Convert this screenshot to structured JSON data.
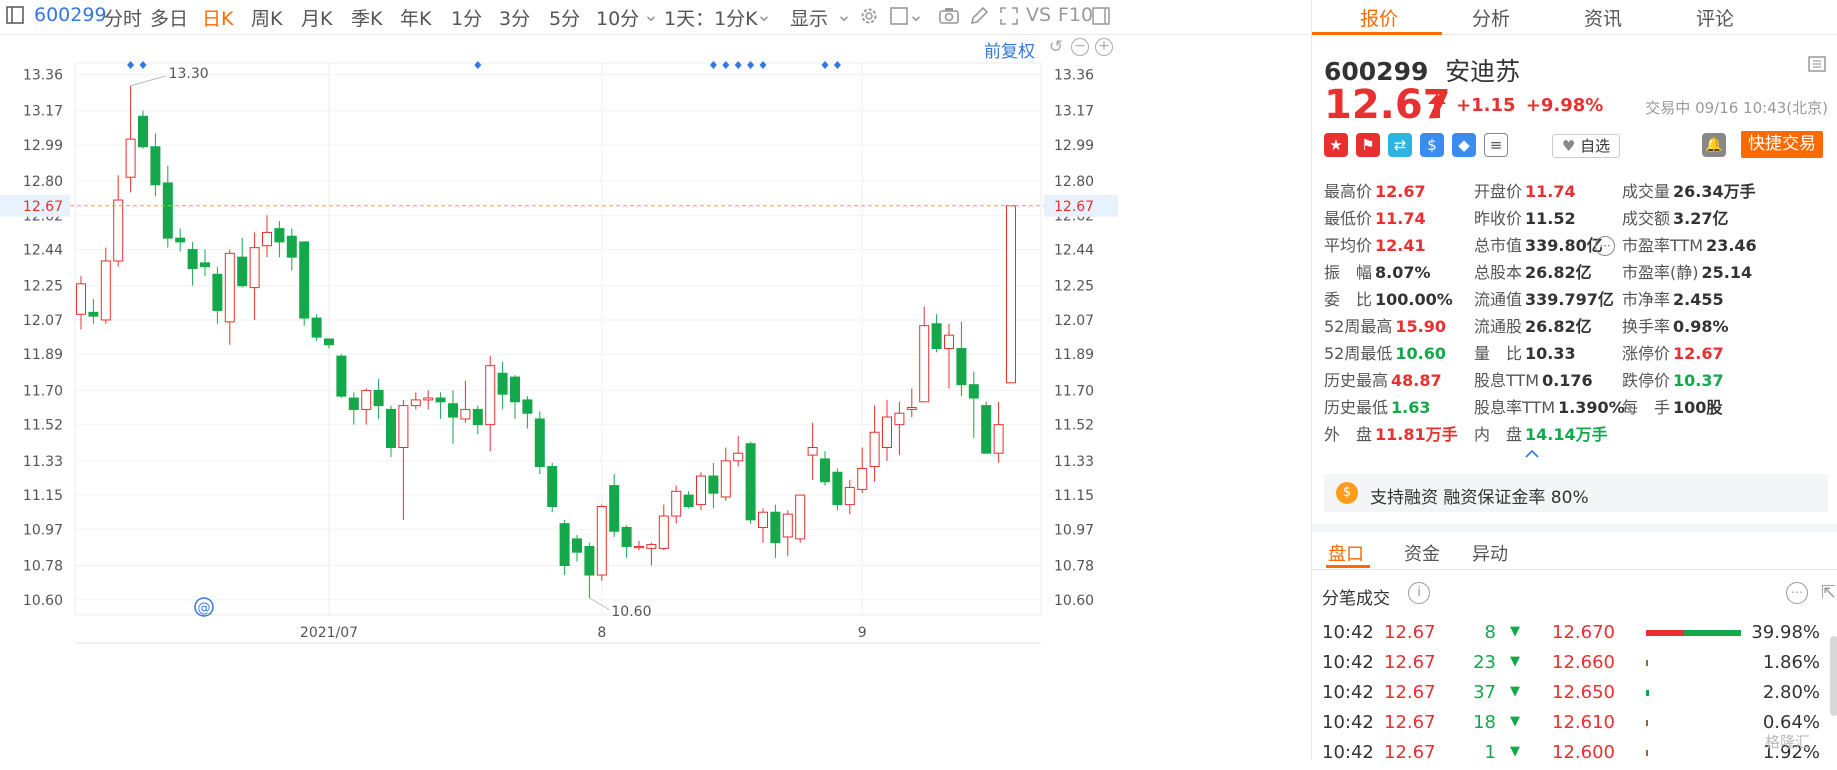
{
  "toolbar": {
    "code": "600299",
    "periods": [
      "分时",
      "多日",
      "日K",
      "周K",
      "月K",
      "季K",
      "年K",
      "1分",
      "3分",
      "5分",
      "10分"
    ],
    "active_period": "日K",
    "minute_select": "1天：1分K",
    "display_label": "显示",
    "vs_label": "VS",
    "f10_label": "F10",
    "adjust_label": "前复权"
  },
  "chart": {
    "y_ticks": [
      "13.36",
      "13.17",
      "12.99",
      "12.80",
      "12.62",
      "12.44",
      "12.25",
      "12.07",
      "11.89",
      "11.70",
      "11.52",
      "11.33",
      "11.15",
      "10.97",
      "10.78",
      "10.60"
    ],
    "x_labels": [
      {
        "text": "2021/07",
        "index": 20
      },
      {
        "text": "8",
        "index": 42
      },
      {
        "text": "9",
        "index": 63
      }
    ],
    "current_price_tag": "12.67",
    "high_annotation": "13.30",
    "low_annotation": "10.60"
  },
  "chart_data": {
    "type": "candlestick",
    "ylim": [
      10.52,
      13.42
    ],
    "current_price": 12.67,
    "candles": [
      [
        12.1,
        12.26,
        12.3,
        12.02
      ],
      [
        12.11,
        12.09,
        12.18,
        12.05
      ],
      [
        12.07,
        12.38,
        12.45,
        12.05
      ],
      [
        12.38,
        12.7,
        12.83,
        12.35
      ],
      [
        12.82,
        13.02,
        13.3,
        12.74
      ],
      [
        13.14,
        12.98,
        13.17,
        12.97
      ],
      [
        12.98,
        12.78,
        13.05,
        12.72
      ],
      [
        12.79,
        12.5,
        12.88,
        12.45
      ],
      [
        12.5,
        12.48,
        12.55,
        12.43
      ],
      [
        12.44,
        12.34,
        12.48,
        12.25
      ],
      [
        12.37,
        12.35,
        12.44,
        12.3
      ],
      [
        12.31,
        12.12,
        12.35,
        12.05
      ],
      [
        12.06,
        12.42,
        12.44,
        11.94
      ],
      [
        12.4,
        12.25,
        12.5,
        12.24
      ],
      [
        12.24,
        12.45,
        12.53,
        12.07
      ],
      [
        12.46,
        12.53,
        12.62,
        12.4
      ],
      [
        12.55,
        12.48,
        12.59,
        12.4
      ],
      [
        12.51,
        12.4,
        12.55,
        12.33
      ],
      [
        12.48,
        12.08,
        12.48,
        12.04
      ],
      [
        12.08,
        11.98,
        12.1,
        11.96
      ],
      [
        11.97,
        11.94,
        11.97,
        11.92
      ],
      [
        11.88,
        11.67,
        11.89,
        11.66
      ],
      [
        11.66,
        11.6,
        11.69,
        11.52
      ],
      [
        11.6,
        11.7,
        11.71,
        11.52
      ],
      [
        11.7,
        11.62,
        11.76,
        11.55
      ],
      [
        11.6,
        11.4,
        11.62,
        11.35
      ],
      [
        11.4,
        11.62,
        11.65,
        11.02
      ],
      [
        11.62,
        11.65,
        11.69,
        11.6
      ],
      [
        11.65,
        11.66,
        11.7,
        11.6
      ],
      [
        11.66,
        11.64,
        11.69,
        11.55
      ],
      [
        11.63,
        11.56,
        11.7,
        11.42
      ],
      [
        11.55,
        11.6,
        11.75,
        11.53
      ],
      [
        11.6,
        11.52,
        11.62,
        11.47
      ],
      [
        11.52,
        11.83,
        11.88,
        11.38
      ],
      [
        11.79,
        11.68,
        11.85,
        11.6
      ],
      [
        11.77,
        11.64,
        11.78,
        11.55
      ],
      [
        11.65,
        11.58,
        11.67,
        11.5
      ],
      [
        11.55,
        11.3,
        11.59,
        11.26
      ],
      [
        11.3,
        11.09,
        11.32,
        11.06
      ],
      [
        11.0,
        10.78,
        11.02,
        10.73
      ],
      [
        10.92,
        10.85,
        10.94,
        10.8
      ],
      [
        10.88,
        10.73,
        10.9,
        10.61
      ],
      [
        10.73,
        11.09,
        11.1,
        10.7
      ],
      [
        11.2,
        10.96,
        11.26,
        10.93
      ],
      [
        10.98,
        10.88,
        10.99,
        10.82
      ],
      [
        10.88,
        10.88,
        10.91,
        10.86
      ],
      [
        10.87,
        10.89,
        10.9,
        10.78
      ],
      [
        10.87,
        11.04,
        11.1,
        10.86
      ],
      [
        11.04,
        11.17,
        11.2,
        11.0
      ],
      [
        11.15,
        11.09,
        11.17,
        11.08
      ],
      [
        11.1,
        11.25,
        11.27,
        11.07
      ],
      [
        11.25,
        11.16,
        11.32,
        11.08
      ],
      [
        11.14,
        11.33,
        11.4,
        11.12
      ],
      [
        11.33,
        11.37,
        11.46,
        11.3
      ],
      [
        11.42,
        11.02,
        11.43,
        11.0
      ],
      [
        10.98,
        11.06,
        11.08,
        10.9
      ],
      [
        11.06,
        10.9,
        11.1,
        10.82
      ],
      [
        10.93,
        11.05,
        11.07,
        10.83
      ],
      [
        10.92,
        11.15,
        11.15,
        10.9
      ],
      [
        11.36,
        11.4,
        11.53,
        11.23
      ],
      [
        11.34,
        11.22,
        11.38,
        11.2
      ],
      [
        11.27,
        11.1,
        11.29,
        11.07
      ],
      [
        11.1,
        11.19,
        11.23,
        11.05
      ],
      [
        11.18,
        11.29,
        11.4,
        11.16
      ],
      [
        11.3,
        11.48,
        11.62,
        11.22
      ],
      [
        11.4,
        11.56,
        11.65,
        11.33
      ],
      [
        11.52,
        11.58,
        11.64,
        11.36
      ],
      [
        11.6,
        11.61,
        11.71,
        11.56
      ],
      [
        11.64,
        12.04,
        12.14,
        11.64
      ],
      [
        12.05,
        11.92,
        12.1,
        11.9
      ],
      [
        11.92,
        11.99,
        12.05,
        11.71
      ],
      [
        11.92,
        11.73,
        12.06,
        11.67
      ],
      [
        11.73,
        11.66,
        11.8,
        11.45
      ],
      [
        11.62,
        11.37,
        11.64,
        11.37
      ],
      [
        11.37,
        11.52,
        11.64,
        11.32
      ],
      [
        11.74,
        12.67,
        12.67,
        11.74
      ]
    ],
    "markers_at": [
      4,
      5,
      32,
      51,
      52,
      53,
      54,
      55,
      60,
      61
    ]
  },
  "panel": {
    "tabs": [
      "报价",
      "分析",
      "资讯",
      "评论"
    ],
    "code": "600299",
    "name": "安迪苏",
    "price": "12.67",
    "change": "+1.15",
    "change_pct": "+9.98%",
    "trade_status": "交易中 09/16 10:43(北京)",
    "watch_label": "自选",
    "quick_trade": "快捷交易",
    "quotes": [
      [
        {
          "label": "最高价",
          "value": "12.67",
          "color": "red"
        },
        {
          "label": "开盘价",
          "value": "11.74",
          "color": "red"
        },
        {
          "label": "成交量",
          "value": "26.34万手",
          "color": "black"
        }
      ],
      [
        {
          "label": "最低价",
          "value": "11.74",
          "color": "red"
        },
        {
          "label": "昨收价",
          "value": "11.52",
          "color": "black"
        },
        {
          "label": "成交额",
          "value": "3.27亿",
          "color": "black"
        }
      ],
      [
        {
          "label": "平均价",
          "value": "12.41",
          "color": "red"
        },
        {
          "label": "总市值",
          "value": "339.80亿",
          "color": "black"
        },
        {
          "label": "市盈率TTM",
          "value": "23.46",
          "color": "black"
        }
      ],
      [
        {
          "label": "振　幅",
          "value": "8.07%",
          "color": "black"
        },
        {
          "label": "总股本",
          "value": "26.82亿",
          "color": "black"
        },
        {
          "label": "市盈率(静)",
          "value": "25.14",
          "color": "black"
        }
      ],
      [
        {
          "label": "委　比",
          "value": "100.00%",
          "color": "black"
        },
        {
          "label": "流通值",
          "value": "339.797亿",
          "color": "black"
        },
        {
          "label": "市净率",
          "value": "2.455",
          "color": "black"
        }
      ],
      [
        {
          "label": "52周最高",
          "value": "15.90",
          "color": "red"
        },
        {
          "label": "流通股",
          "value": "26.82亿",
          "color": "black"
        },
        {
          "label": "换手率",
          "value": "0.98%",
          "color": "black"
        }
      ],
      [
        {
          "label": "52周最低",
          "value": "10.60",
          "color": "green"
        },
        {
          "label": "量　比",
          "value": "10.33",
          "color": "black"
        },
        {
          "label": "涨停价",
          "value": "12.67",
          "color": "red"
        }
      ],
      [
        {
          "label": "历史最高",
          "value": "48.87",
          "color": "red"
        },
        {
          "label": "股息TTM",
          "value": "0.176",
          "color": "black"
        },
        {
          "label": "跌停价",
          "value": "10.37",
          "color": "green"
        }
      ],
      [
        {
          "label": "历史最低",
          "value": "1.63",
          "color": "green"
        },
        {
          "label": "股息率TTM",
          "value": "1.390%",
          "color": "black"
        },
        {
          "label": "每　手",
          "value": "100股",
          "color": "black"
        }
      ],
      [
        {
          "label": "外　盘",
          "value": "11.81万手",
          "color": "red"
        },
        {
          "label": "内　盘",
          "value": "14.14万手",
          "color": "green"
        },
        null
      ]
    ],
    "margin_text": "支持融资 融资保证金率 80%",
    "subtabs": [
      "盘口",
      "资金",
      "异动"
    ],
    "tick_title": "分笔成交",
    "ticks": [
      {
        "time": "10:42",
        "price": "12.67",
        "vol": "8",
        "level": "12.670",
        "pct": "39.98%",
        "bar": 0.95
      },
      {
        "time": "10:42",
        "price": "12.67",
        "vol": "23",
        "level": "12.660",
        "pct": "1.86%",
        "bar": 0.02
      },
      {
        "time": "10:42",
        "price": "12.67",
        "vol": "37",
        "level": "12.650",
        "pct": "2.80%",
        "bar": 0.03
      },
      {
        "time": "10:42",
        "price": "12.67",
        "vol": "18",
        "level": "12.610",
        "pct": "0.64%",
        "bar": 0.01
      },
      {
        "time": "10:42",
        "price": "12.67",
        "vol": "1",
        "level": "12.600",
        "pct": "1.92%",
        "bar": 0.02
      }
    ],
    "watermark": "格隆汇"
  }
}
